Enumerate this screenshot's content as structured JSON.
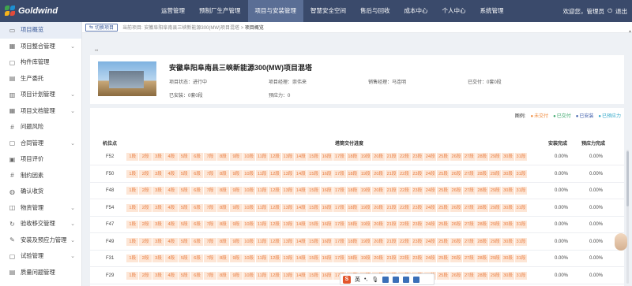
{
  "brand": {
    "name": "Goldwind"
  },
  "nav": [
    {
      "label": "运营管理"
    },
    {
      "label": "预制厂生产管理"
    },
    {
      "label": "项目与安装管理"
    },
    {
      "label": "智慧安全空间"
    },
    {
      "label": "售后与回收"
    },
    {
      "label": "成本中心"
    },
    {
      "label": "个人中心"
    },
    {
      "label": "系统管理"
    }
  ],
  "user": {
    "greeting": "欢迎您，管理员",
    "logout": "退出"
  },
  "sidebar": [
    {
      "label": "项目概览",
      "icon": "monitor-icon",
      "glyph": "▭",
      "active": true,
      "chevron": ""
    },
    {
      "label": "项目整合管理",
      "icon": "grid-icon",
      "glyph": "▦",
      "chevron": "⌄"
    },
    {
      "label": "构件库管理",
      "icon": "folder-icon",
      "glyph": "▢",
      "chevron": ""
    },
    {
      "label": "生产委托",
      "icon": "document-icon",
      "glyph": "▤",
      "chevron": ""
    },
    {
      "label": "项目计划管理",
      "icon": "calendar-icon",
      "glyph": "▥",
      "chevron": "⌄"
    },
    {
      "label": "项目文档管理",
      "icon": "book-icon",
      "glyph": "▦",
      "chevron": "⌄"
    },
    {
      "label": "问题风险",
      "icon": "hash-icon",
      "glyph": "#",
      "chevron": ""
    },
    {
      "label": "合同管理",
      "icon": "contract-icon",
      "glyph": "▢",
      "chevron": "⌄"
    },
    {
      "label": "项目评价",
      "icon": "star-icon",
      "glyph": "▣",
      "chevron": ""
    },
    {
      "label": "制约因素",
      "icon": "hash-icon",
      "glyph": "#",
      "chevron": ""
    },
    {
      "label": "确认收货",
      "icon": "check-icon",
      "glyph": "◍",
      "chevron": ""
    },
    {
      "label": "物资管理",
      "icon": "box-icon",
      "glyph": "◫",
      "chevron": "⌄"
    },
    {
      "label": "验收移交管理",
      "icon": "handover-icon",
      "glyph": "↻",
      "chevron": "⌄"
    },
    {
      "label": "安装及预应力管理",
      "icon": "wrench-icon",
      "glyph": "✎",
      "chevron": "⌄"
    },
    {
      "label": "试验管理",
      "icon": "flask-icon",
      "glyph": "▢",
      "chevron": "⌄"
    },
    {
      "label": "质量问题管理",
      "icon": "quality-icon",
      "glyph": "▤",
      "chevron": ""
    }
  ],
  "breadcrumb": {
    "switch_label": "切换项目",
    "path": "当前项目: 安徽阜阳阜南县三峡新能源300(MW)项目混塔 >",
    "current": "项目概览"
  },
  "project": {
    "title": "安徽阜阳阜南县三峡新能源300(MW)项目混塔",
    "status": "项目状态：进行中",
    "manager": "项目经理：崇伟来",
    "sales": "销售经理：马连明",
    "delivered": "已交付：0套0段",
    "installed": "已安装：0套0段",
    "prestress": "预应力：0",
    "ellipsis": "••"
  },
  "legend": {
    "prefix": "图例:",
    "items": [
      {
        "label": "未交付",
        "color": "#f08a3c"
      },
      {
        "label": "已交付",
        "color": "#3aa66a"
      },
      {
        "label": "已安装",
        "color": "#3a5aa8"
      },
      {
        "label": "已预应力",
        "color": "#2fa6c8"
      }
    ]
  },
  "table": {
    "headers": {
      "position": "机位点",
      "progress": "塔筒交付进度",
      "install": "安装完成",
      "prestress": "预应力完成"
    },
    "segments": [
      "1段",
      "2段",
      "3段",
      "4段",
      "5段",
      "6段",
      "7段",
      "8段",
      "9段",
      "10段",
      "11段",
      "12段",
      "13段",
      "14段",
      "15段",
      "16段",
      "17段",
      "18段",
      "19段",
      "20段",
      "21段",
      "22段",
      "23段",
      "24段",
      "25段",
      "26段",
      "27段",
      "28段",
      "29段",
      "30段",
      "31段"
    ],
    "rows": [
      {
        "code": "F52",
        "install": "0.00%",
        "prestress": "0.00%"
      },
      {
        "code": "F50",
        "install": "0.00%",
        "prestress": "0.00%"
      },
      {
        "code": "F48",
        "install": "0.00%",
        "prestress": "0.00%"
      },
      {
        "code": "F54",
        "install": "0.00%",
        "prestress": "0.00%"
      },
      {
        "code": "F47",
        "install": "0.00%",
        "prestress": "0.00%"
      },
      {
        "code": "F49",
        "install": "0.00%",
        "prestress": "0.00%"
      },
      {
        "code": "F31",
        "install": "0.00%",
        "prestress": "0.00%"
      },
      {
        "code": "F29",
        "install": "0.00%",
        "prestress": "0.00%"
      }
    ]
  },
  "ime": {
    "label": "英"
  }
}
